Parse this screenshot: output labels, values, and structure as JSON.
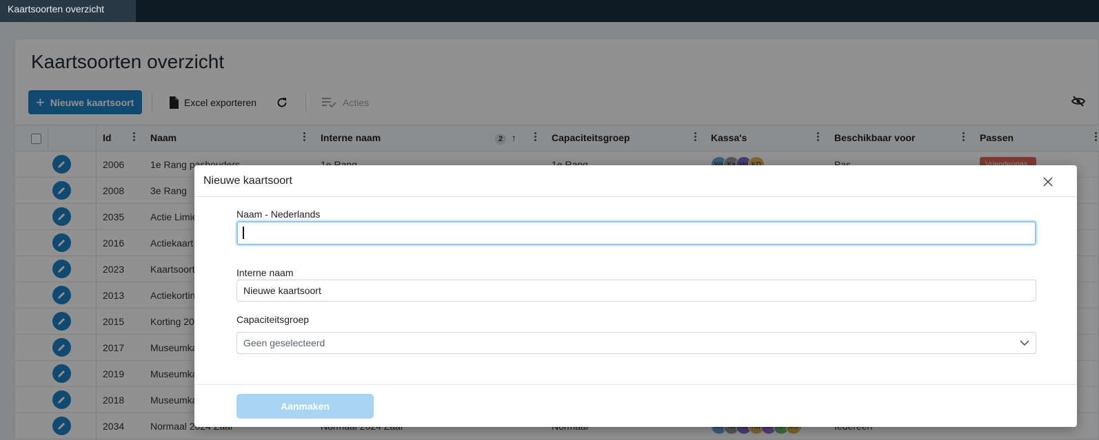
{
  "window": {
    "tab_title": "Kaartsoorten overzicht"
  },
  "page": {
    "title": "Kaartsoorten overzicht"
  },
  "toolbar": {
    "new_label": "Nieuwe kaartsoort",
    "export_label": "Excel exporteren",
    "actions_label": "Acties"
  },
  "grid": {
    "columns": [
      "Id",
      "Naam",
      "Interne naam",
      "Capaciteitsgroep",
      "Kassa's",
      "Beschikbaar voor",
      "Passen"
    ],
    "sort_index": "2",
    "rows": [
      {
        "id": "2006",
        "naam": "1e Rang pashouders",
        "interne": "1e Rang",
        "cap": "1e Rang",
        "kassas": [
          "We",
          "Ka",
          "Ho",
          "KD"
        ],
        "beschikbaar": "Pas",
        "passen": "Vriendenpas"
      },
      {
        "id": "2008",
        "naam": "3e Rang"
      },
      {
        "id": "2035",
        "naam": "Actie Limie"
      },
      {
        "id": "2016",
        "naam": "Actiekaart"
      },
      {
        "id": "2023",
        "naam": "Kaartsoort"
      },
      {
        "id": "2013",
        "naam": "Actiekortin"
      },
      {
        "id": "2015",
        "naam": "Korting 20"
      },
      {
        "id": "2017",
        "naam": "Museumka"
      },
      {
        "id": "2019",
        "naam": "Museumka"
      },
      {
        "id": "2018",
        "naam": "Museumka"
      },
      {
        "id": "2034",
        "naam": "Normaal 2024 Zaal",
        "interne": "Normaal 2024 Zaal",
        "cap": "Normaal",
        "kassas": [
          "We",
          "Ka",
          "Ho",
          "KD",
          "KA",
          "KA",
          "Me"
        ],
        "beschikbaar": "Iedereen"
      }
    ]
  },
  "modal": {
    "title": "Nieuwe kaartsoort",
    "naam_label": "Naam - Nederlands",
    "naam_value": "",
    "interne_label": "Interne naam",
    "interne_value": "Nieuwe kaartsoort",
    "cap_label": "Capaciteitsgroep",
    "cap_value": "Geen geselecteerd",
    "create_label": "Aanmaken"
  },
  "colors": {
    "accent": "#1d83c6",
    "disabled_button": "#a8d6f2",
    "pill": "#e0685a"
  }
}
